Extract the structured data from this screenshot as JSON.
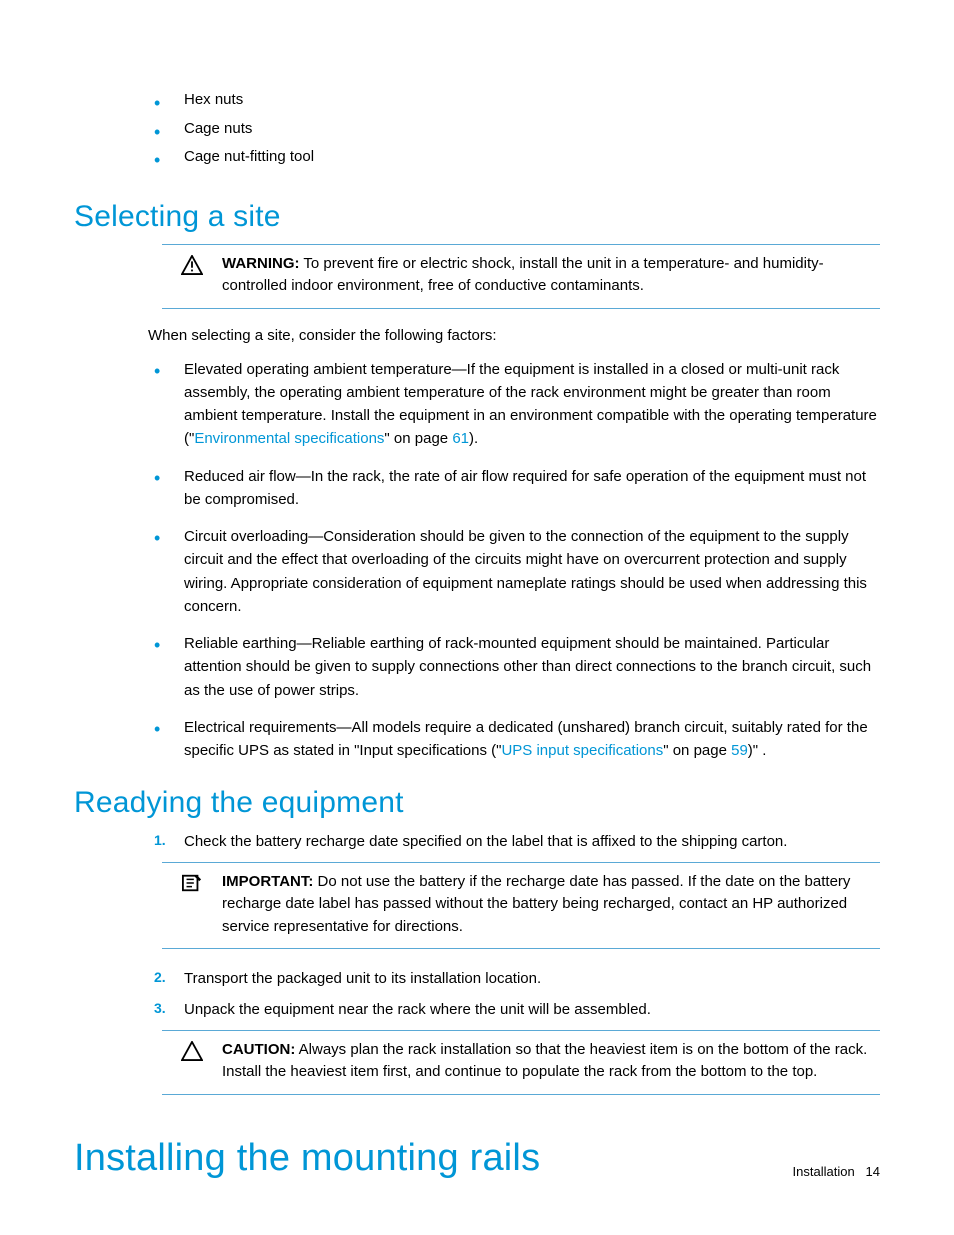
{
  "intro_bullets": [
    "Hex nuts",
    "Cage nuts",
    "Cage nut-fitting tool"
  ],
  "section1": {
    "heading": "Selecting a site",
    "warning_label": "WARNING:",
    "warning_text": "  To prevent fire or electric shock, install the unit in a temperature- and humidity-controlled indoor environment, free of conductive contaminants.",
    "factors_intro": "When selecting a site, consider the following factors:",
    "factor1_a": "Elevated operating ambient temperature—If the equipment is installed in a closed or multi-unit rack assembly, the operating ambient temperature of the rack environment might be greater than room ambient temperature. Install the equipment in an environment compatible with the operating temperature (\"",
    "factor1_link": "Environmental specifications",
    "factor1_b": "\" on page ",
    "factor1_page": "61",
    "factor1_c": ").",
    "factor2": "Reduced air flow—In the rack, the rate of air flow required for safe operation of the equipment must not be compromised.",
    "factor3": "Circuit overloading—Consideration should be given to the connection of the equipment to the supply circuit and the effect that overloading of the circuits might have on overcurrent protection and supply wiring. Appropriate consideration of equipment nameplate ratings should be used when addressing this concern.",
    "factor4": "Reliable earthing—Reliable earthing of rack-mounted equipment should be maintained. Particular attention should be given to supply connections other than direct connections to the branch circuit, such as the use of power strips.",
    "factor5_a": "Electrical requirements—All models require a dedicated (unshared) branch circuit, suitably rated for the specific UPS as stated in \"Input specifications (\"",
    "factor5_link": "UPS input specifications",
    "factor5_b": "\" on page ",
    "factor5_page": "59",
    "factor5_c": ")\" ."
  },
  "section2": {
    "heading": "Readying the equipment",
    "step1_num": "1.",
    "step1": "Check the battery recharge date specified on the label that is affixed to the shipping carton.",
    "important_label": "IMPORTANT:",
    "important_text": "  Do not use the battery if the recharge date has passed. If the date on the battery recharge date label has passed without the battery being recharged, contact an HP authorized service representative for directions.",
    "step2_num": "2.",
    "step2": "Transport the packaged unit to its installation location.",
    "step3_num": "3.",
    "step3": "Unpack the equipment near the rack where the unit will be assembled.",
    "caution_label": "CAUTION:",
    "caution_text": "  Always plan the rack installation so that the heaviest item is on the bottom of the rack. Install the heaviest item first, and continue to populate the rack from the bottom to the top."
  },
  "section3": {
    "heading": "Installing the mounting rails"
  },
  "footer": {
    "label": "Installation",
    "page": "14"
  }
}
